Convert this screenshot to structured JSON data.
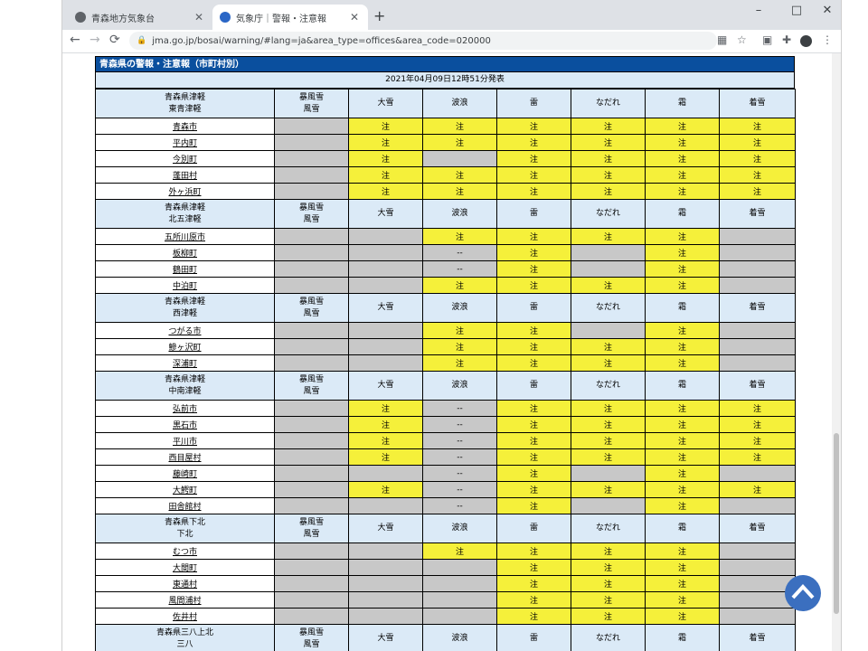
{
  "tabs": [
    {
      "label": "青森地方気象台"
    },
    {
      "label": "気象庁｜警報・注意報"
    }
  ],
  "address": {
    "url": "jma.go.jp/bosai/warning/#lang=ja&area_type=offices&area_code=020000"
  },
  "page": {
    "title": "青森県の警報・注意報（市町村別）",
    "issued": "2021年04月09日12時51分発表"
  },
  "columns": [
    "暴風雪\n風雪",
    "大雪",
    "波浪",
    "雷",
    "なだれ",
    "霜",
    "着雪"
  ],
  "groups": [
    {
      "region": "青森県津軽\n東青津軽",
      "rows": [
        {
          "city": "青森市",
          "cells": [
            "g",
            "注",
            "注",
            "注",
            "注",
            "注",
            "注"
          ]
        },
        {
          "city": "平内町",
          "cells": [
            "g",
            "注",
            "注",
            "注",
            "注",
            "注",
            "注"
          ]
        },
        {
          "city": "今別町",
          "cells": [
            "g",
            "注",
            "g",
            "注",
            "注",
            "注",
            "注"
          ]
        },
        {
          "city": "蓬田村",
          "cells": [
            "g",
            "注",
            "注",
            "注",
            "注",
            "注",
            "注"
          ]
        },
        {
          "city": "外ヶ浜町",
          "cells": [
            "g",
            "注",
            "注",
            "注",
            "注",
            "注",
            "注"
          ]
        }
      ]
    },
    {
      "region": "青森県津軽\n北五津軽",
      "rows": [
        {
          "city": "五所川原市",
          "cells": [
            "g",
            "g",
            "注",
            "注",
            "注",
            "注",
            "g"
          ]
        },
        {
          "city": "板柳町",
          "cells": [
            "g",
            "g",
            "--",
            "注",
            "g",
            "注",
            "g"
          ]
        },
        {
          "city": "鶴田町",
          "cells": [
            "g",
            "g",
            "--",
            "注",
            "g",
            "注",
            "g"
          ]
        },
        {
          "city": "中泊町",
          "cells": [
            "g",
            "g",
            "注",
            "注",
            "注",
            "注",
            "g"
          ]
        }
      ]
    },
    {
      "region": "青森県津軽\n西津軽",
      "rows": [
        {
          "city": "つがる市",
          "cells": [
            "g",
            "g",
            "注",
            "注",
            "g",
            "注",
            "g"
          ]
        },
        {
          "city": "鰺ヶ沢町",
          "cells": [
            "g",
            "g",
            "注",
            "注",
            "注",
            "注",
            "g"
          ]
        },
        {
          "city": "深浦町",
          "cells": [
            "g",
            "g",
            "注",
            "注",
            "注",
            "注",
            "g"
          ]
        }
      ]
    },
    {
      "region": "青森県津軽\n中南津軽",
      "rows": [
        {
          "city": "弘前市",
          "cells": [
            "g",
            "注",
            "--",
            "注",
            "注",
            "注",
            "注"
          ]
        },
        {
          "city": "黒石市",
          "cells": [
            "g",
            "注",
            "--",
            "注",
            "注",
            "注",
            "注"
          ]
        },
        {
          "city": "平川市",
          "cells": [
            "g",
            "注",
            "--",
            "注",
            "注",
            "注",
            "注"
          ]
        },
        {
          "city": "西目屋村",
          "cells": [
            "g",
            "注",
            "--",
            "注",
            "注",
            "注",
            "注"
          ]
        },
        {
          "city": "藤崎町",
          "cells": [
            "g",
            "g",
            "--",
            "注",
            "g",
            "注",
            "g"
          ]
        },
        {
          "city": "大鰐町",
          "cells": [
            "g",
            "注",
            "--",
            "注",
            "注",
            "注",
            "注"
          ]
        },
        {
          "city": "田舎館村",
          "cells": [
            "g",
            "g",
            "--",
            "注",
            "g",
            "注",
            "g"
          ]
        }
      ]
    },
    {
      "region": "青森県下北\n下北",
      "rows": [
        {
          "city": "むつ市",
          "cells": [
            "g",
            "g",
            "注",
            "注",
            "注",
            "注",
            "g"
          ]
        },
        {
          "city": "大間町",
          "cells": [
            "g",
            "g",
            "g",
            "注",
            "注",
            "注",
            "g"
          ]
        },
        {
          "city": "東通村",
          "cells": [
            "g",
            "g",
            "g",
            "注",
            "注",
            "注",
            "g"
          ]
        },
        {
          "city": "風間浦村",
          "cells": [
            "g",
            "g",
            "g",
            "注",
            "注",
            "注",
            "g"
          ]
        },
        {
          "city": "佐井村",
          "cells": [
            "g",
            "g",
            "g",
            "注",
            "注",
            "注",
            "g"
          ]
        }
      ]
    },
    {
      "region": "青森県三八上北\n三八",
      "rows": []
    }
  ],
  "colors": {
    "warning_yellow": "#f5f03a",
    "gray": "#c8c8c8",
    "header_blue": "#0a4f9e",
    "light_blue": "#dbeaf7"
  }
}
